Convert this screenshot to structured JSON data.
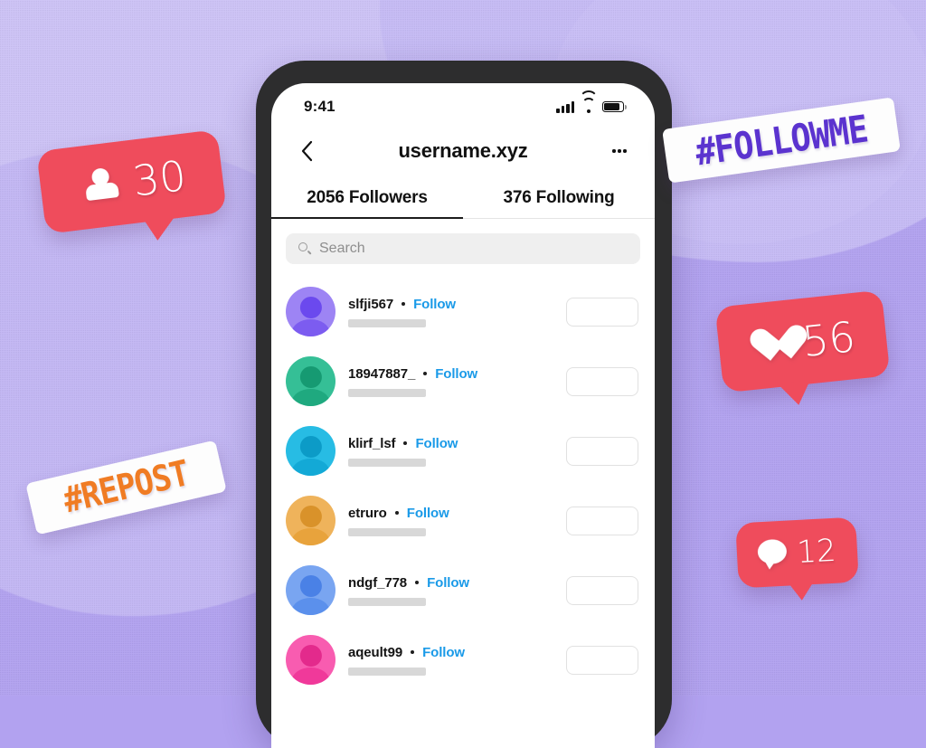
{
  "background": {
    "base_color": "#b2a2f0",
    "blob_color": "#c9bef6"
  },
  "phone": {
    "frame_color": "#2d2d2e",
    "statusbar": {
      "time": "9:41",
      "icons": [
        "cellular-signal-icon",
        "wifi-icon",
        "battery-icon"
      ]
    },
    "navbar": {
      "back_icon": "chevron-left-icon",
      "title": "username.xyz",
      "more_icon": "ellipsis-icon"
    },
    "tabs": [
      {
        "label": "2056 Followers",
        "active": true
      },
      {
        "label": "376 Following",
        "active": false
      }
    ],
    "search": {
      "icon": "search-icon",
      "placeholder": "Search",
      "value": ""
    },
    "list": {
      "follow_label": "Follow",
      "items": [
        {
          "username": "slfji567",
          "avatar_color": "#7c5cf0",
          "avatar_shade": "#6b49ee"
        },
        {
          "username": "18947887_",
          "avatar_color": "#1fa97f",
          "avatar_shade": "#169a72"
        },
        {
          "username": "klirf_lsf",
          "avatar_color": "#13a9d6",
          "avatar_shade": "#0c9bc7"
        },
        {
          "username": "etruro",
          "avatar_color": "#e8a33c",
          "avatar_shade": "#d9922a"
        },
        {
          "username": "ndgf_778",
          "avatar_color": "#5b90ec",
          "avatar_shade": "#4a81e6"
        },
        {
          "username": "aqeult99",
          "avatar_color": "#f0399a",
          "avatar_shade": "#e32a8c"
        }
      ]
    }
  },
  "badges": [
    {
      "id": "followers-badge",
      "icon": "person-icon",
      "count": "30",
      "color": "#ef4c5c"
    },
    {
      "id": "likes-badge",
      "icon": "heart-icon",
      "count": "56",
      "color": "#ef4c5c"
    },
    {
      "id": "comments-badge",
      "icon": "comment-icon",
      "count": "12",
      "color": "#ef4c5c"
    }
  ],
  "stickers": [
    {
      "id": "followme-sticker",
      "text": "#FOLLOWME",
      "color": "#5b33cf"
    },
    {
      "id": "repost-sticker",
      "text": "#REPOST",
      "color": "#f07c24"
    }
  ]
}
